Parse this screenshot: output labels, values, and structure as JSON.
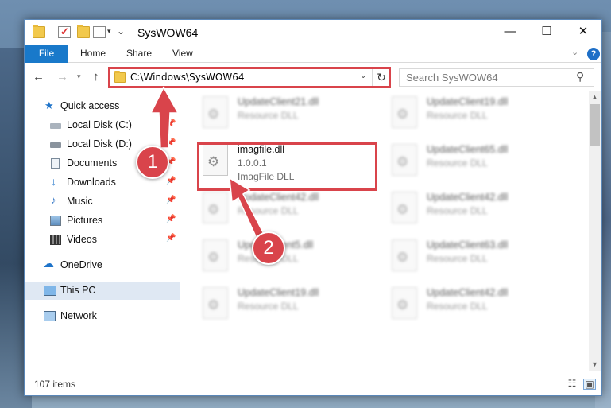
{
  "window": {
    "title": "SysWOW64"
  },
  "ribbon": {
    "tabs": [
      "File",
      "Home",
      "Share",
      "View"
    ]
  },
  "address": {
    "path": "C:\\Windows\\SysWOW64"
  },
  "search": {
    "placeholder": "Search SysWOW64"
  },
  "sidebar": {
    "items": [
      {
        "label": "Quick access",
        "icon": "star-icon"
      },
      {
        "label": "Local Disk (C:)",
        "icon": "drive-icon"
      },
      {
        "label": "Local Disk (D:)",
        "icon": "drive-icon"
      },
      {
        "label": "Documents",
        "icon": "documents-icon"
      },
      {
        "label": "Downloads",
        "icon": "downloads-icon"
      },
      {
        "label": "Music",
        "icon": "music-icon"
      },
      {
        "label": "Pictures",
        "icon": "pictures-icon"
      },
      {
        "label": "Videos",
        "icon": "videos-icon"
      },
      {
        "label": "OneDrive",
        "icon": "onedrive-icon"
      },
      {
        "label": "This PC",
        "icon": "computer-icon"
      },
      {
        "label": "Network",
        "icon": "network-icon"
      }
    ]
  },
  "files": {
    "left": [
      {
        "name": "UpdateClient21.dll",
        "type": "Resource DLL"
      },
      {
        "name": "imagfile.dll",
        "version": "1.0.0.1",
        "type": "ImagFile DLL"
      },
      {
        "name": "UpdateClient42.dll",
        "type": "Resource DLL"
      },
      {
        "name": "UpdateClient5.dll",
        "type": "Resource DLL"
      },
      {
        "name": "UpdateClient19.dll",
        "type": "Resource DLL"
      }
    ],
    "right": [
      {
        "name": "UpdateClient19.dll",
        "type": "Resource DLL"
      },
      {
        "name": "UpdateClient65.dll",
        "type": "Resource DLL"
      },
      {
        "name": "UpdateClient42.dll",
        "type": "Resource DLL"
      },
      {
        "name": "UpdateClient63.dll",
        "type": "Resource DLL"
      },
      {
        "name": "UpdateClient42.dll",
        "type": "Resource DLL"
      }
    ]
  },
  "status": {
    "item_count": "107 items"
  },
  "callouts": {
    "step1": "1",
    "step2": "2"
  },
  "colors": {
    "accent": "#1979ca",
    "highlight": "#d9444b",
    "folder": "#f2c94c"
  }
}
